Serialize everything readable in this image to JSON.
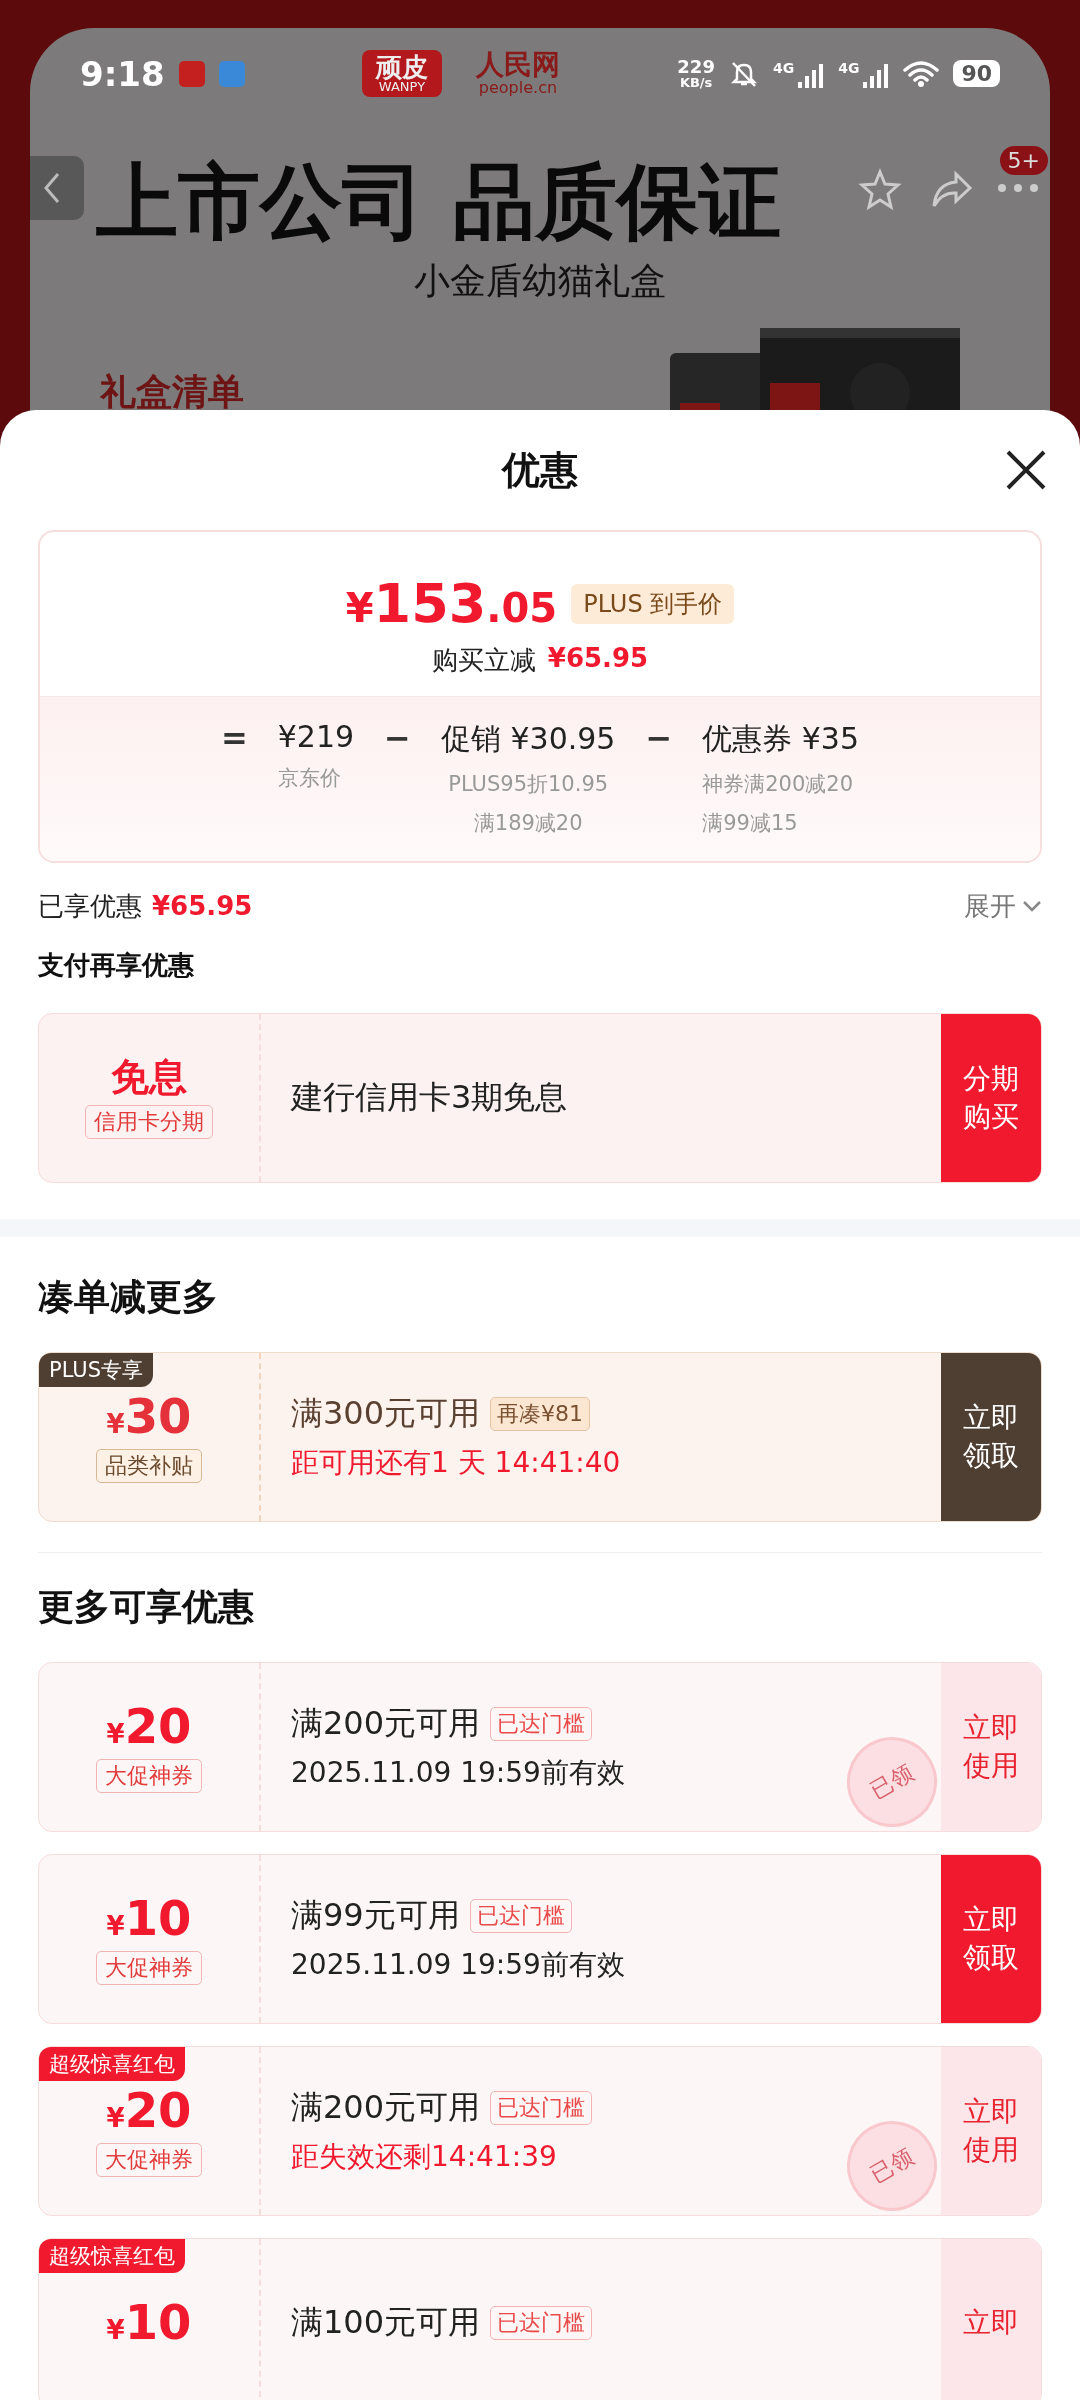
{
  "status_bar": {
    "time": "9:18",
    "net_speed": "229",
    "net_unit": "KB/s",
    "signal_1": "4G",
    "signal_2": "4G",
    "battery": "90"
  },
  "product_page": {
    "brand_logo": "顽皮",
    "brand_logo_sub": "WANPY",
    "partner_logo": "人民网",
    "partner_logo_sub": "people.cn",
    "headline": "上市公司 品质保证",
    "subtitle": "小金盾幼猫礼盒",
    "section_label": "礼盒清单",
    "cart_badge": "5+"
  },
  "sheet": {
    "title": "优惠"
  },
  "price_card": {
    "currency": "¥",
    "price_int": "153",
    "price_dec": ".05",
    "price_tag": "PLUS 到手价",
    "discount_label": "购买立减",
    "discount_value": "¥65.95",
    "breakdown": [
      {
        "sign": "=",
        "value": "¥219",
        "notes": [
          "京东价"
        ]
      },
      {
        "sign": "−",
        "value": "促销 ¥30.95",
        "notes": [
          "PLUS95折10.95",
          "满189减20"
        ]
      },
      {
        "sign": "−",
        "value": "优惠券 ¥35",
        "notes": [
          "神券满200减20",
          "满99减15"
        ]
      }
    ]
  },
  "enjoyed": {
    "label": "已享优惠",
    "amount": "¥65.95",
    "toggle": "展开",
    "expanded": false
  },
  "pay_section": {
    "title": "支付再享优惠",
    "offer": {
      "badge_title": "免息",
      "badge_sub": "信用卡分期",
      "text": "建行信用卡3期免息",
      "button": "分期购买"
    }
  },
  "combo_section": {
    "title": "凑单减更多",
    "coupon": {
      "tag": "PLUS专享",
      "currency": "¥",
      "amount": "30",
      "type": "品类补贴",
      "condition": "满300元可用",
      "hint": "再凑¥81",
      "countdown": "距可用还有1 天 14:41:40",
      "button": "立即领取"
    }
  },
  "more_section": {
    "title": "更多可享优惠",
    "coupons": [
      {
        "kind": "dated",
        "currency": "¥",
        "amount": "20",
        "type": "大促神券",
        "condition": "满200元可用",
        "badge": "已达门槛",
        "validity": "2025.11.09 19:59前有效",
        "button": "立即使用",
        "claimed": true,
        "stamp": "已领"
      },
      {
        "kind": "dated",
        "currency": "¥",
        "amount": "10",
        "type": "大促神券",
        "condition": "满99元可用",
        "badge": "已达门槛",
        "validity": "2025.11.09 19:59前有效",
        "button": "立即领取",
        "claimed": false
      },
      {
        "kind": "timed",
        "tag": "超级惊喜红包",
        "currency": "¥",
        "amount": "20",
        "type": "大促神券",
        "condition": "满200元可用",
        "badge": "已达门槛",
        "validity": "距失效还剩14:41:39",
        "button": "立即使用",
        "claimed": true,
        "stamp": "已领"
      },
      {
        "tag": "超级惊喜红包",
        "currency": "¥",
        "amount": "10",
        "condition": "满100元可用",
        "badge": "已达门槛",
        "button": "立即",
        "claimed": true
      }
    ]
  }
}
